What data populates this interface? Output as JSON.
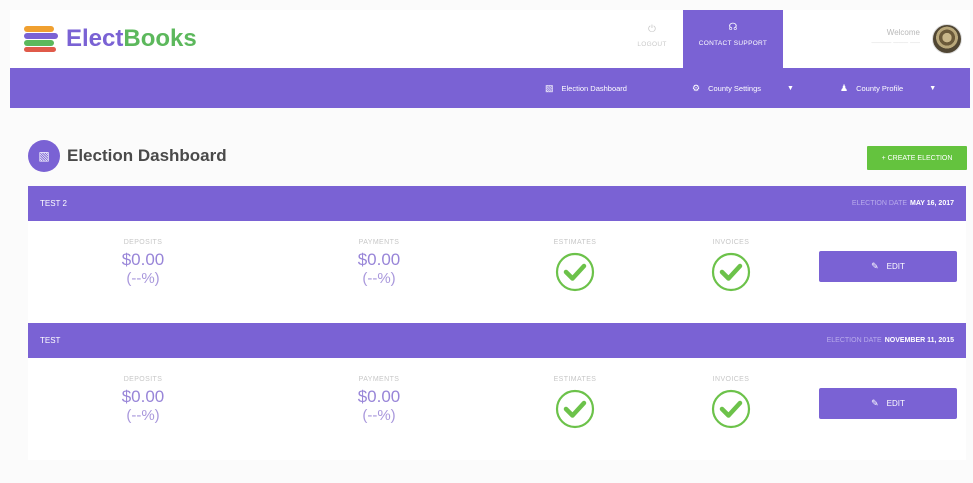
{
  "brand": {
    "name_part1": "Elect",
    "name_part2": "Books"
  },
  "header": {
    "logout_label": "LOGOUT",
    "support_label": "CONTACT SUPPORT",
    "welcome_label": "Welcome",
    "username": "──── ─── ──"
  },
  "nav": {
    "dashboard_label": "Election Dashboard",
    "county_settings_label": "County Settings",
    "county_profile_label": "County Profile"
  },
  "page": {
    "title": "Election Dashboard",
    "create_button_label": "+ CREATE ELECTION"
  },
  "labels": {
    "deposits": "DEPOSITS",
    "payments": "PAYMENTS",
    "estimates": "ESTIMATES",
    "invoices": "INVOICES",
    "edit": "EDIT",
    "election_date": "ELECTION DATE"
  },
  "elections": [
    {
      "name": "TEST 2",
      "date": "MAY 16, 2017",
      "deposits": "$0.00",
      "deposits_pct": "(--%)",
      "payments": "$0.00",
      "payments_pct": "(--%)",
      "estimates_done": true,
      "invoices_done": true
    },
    {
      "name": "TEST",
      "date": "NOVEMBER 11, 2015",
      "deposits": "$0.00",
      "deposits_pct": "(--%)",
      "payments": "$0.00",
      "payments_pct": "(--%)",
      "estimates_done": true,
      "invoices_done": true
    }
  ],
  "colors": {
    "primary": "#7a62d4",
    "success": "#64c33e",
    "check": "#6cc24a"
  },
  "icons": {
    "logout": "power-icon",
    "support": "headset-icon",
    "dashboard": "ballot-box-icon",
    "settings": "gear-icon",
    "profile": "user-icon",
    "dropdown": "caret-down-icon",
    "edit": "pencil-icon",
    "status": "check-circle-icon"
  }
}
